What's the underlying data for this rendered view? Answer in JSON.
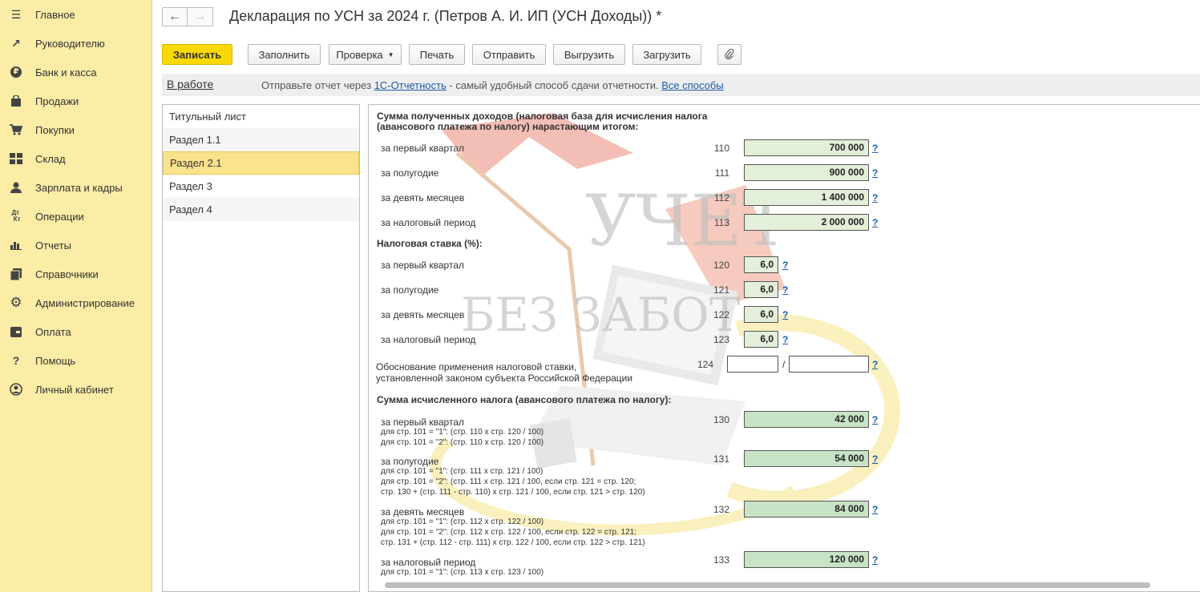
{
  "sidebar": {
    "items": [
      {
        "label": "Главное",
        "icon": "menu-icon"
      },
      {
        "label": "Руководителю",
        "icon": "trend-icon"
      },
      {
        "label": "Банк и касса",
        "icon": "ruble-icon"
      },
      {
        "label": "Продажи",
        "icon": "bag-icon"
      },
      {
        "label": "Покупки",
        "icon": "cart-icon"
      },
      {
        "label": "Склад",
        "icon": "warehouse-icon"
      },
      {
        "label": "Зарплата и кадры",
        "icon": "person-icon"
      },
      {
        "label": "Операции",
        "icon": "dt-kt-icon"
      },
      {
        "label": "Отчеты",
        "icon": "bar-chart-icon"
      },
      {
        "label": "Справочники",
        "icon": "books-icon"
      },
      {
        "label": "Администрирование",
        "icon": "gear-icon"
      },
      {
        "label": "Оплата",
        "icon": "wallet-icon"
      },
      {
        "label": "Помощь",
        "icon": "question-icon"
      },
      {
        "label": "Личный кабинет",
        "icon": "account-icon"
      }
    ]
  },
  "header": {
    "back": "←",
    "forward": "→",
    "title": "Декларация по УСН за 2024 г. (Петров А. И. ИП (УСН Доходы)) *"
  },
  "toolbar": {
    "save": "Записать",
    "fill": "Заполнить",
    "check": "Проверка",
    "print": "Печать",
    "send": "Отправить",
    "export": "Выгрузить",
    "import": "Загрузить",
    "attach_icon": "paperclip-icon"
  },
  "strip": {
    "status": "В работе",
    "msg_prefix": "Отправьте отчет через",
    "link1": "1С-Отчетность",
    "msg_mid": " - самый удобный способ сдачи отчетности.",
    "link2": "Все способы"
  },
  "sections": [
    "Титульный лист",
    "Раздел 1.1",
    "Раздел 2.1",
    "Раздел 3",
    "Раздел 4"
  ],
  "active_section": "Раздел 2.1",
  "form": {
    "income_header_1": "Сумма полученных доходов (налоговая база для исчисления налога",
    "income_header_2": "(авансового платежа по налогу) нарастающим итогом:",
    "rate_header": "Налоговая ставка (%):",
    "tax_header": "Сумма исчисленного налога (авансового платежа по налогу):",
    "justif_1": "Обоснование применения налоговой ставки,",
    "justif_2": "установленной законом субъекта Российской Федерации",
    "justif_code": "124",
    "slash": "/",
    "q": "?",
    "income_rows": [
      {
        "label": "за первый квартал",
        "code": "110",
        "value": "700 000"
      },
      {
        "label": "за полугодие",
        "code": "111",
        "value": "900 000"
      },
      {
        "label": "за девять месяцев",
        "code": "112",
        "value": "1 400 000"
      },
      {
        "label": "за налоговый период",
        "code": "113",
        "value": "2 000 000"
      }
    ],
    "rate_rows": [
      {
        "label": "за первый квартал",
        "code": "120",
        "value": "6,0"
      },
      {
        "label": "за полугодие",
        "code": "121",
        "value": "6,0"
      },
      {
        "label": "за девять месяцев",
        "code": "122",
        "value": "6,0"
      },
      {
        "label": "за налоговый период",
        "code": "123",
        "value": "6,0"
      }
    ],
    "tax_rows": [
      {
        "label": "за первый квартал",
        "code": "130",
        "value": "42 000",
        "formula": [
          "для стр. 101 = \"1\": (стр. 110 х стр. 120 / 100)",
          "для стр. 101 = \"2\": (стр. 110 х стр. 120 / 100)"
        ]
      },
      {
        "label": "за полугодие",
        "code": "131",
        "value": "54 000",
        "formula": [
          "для стр. 101 = \"1\": (стр. 111 х стр. 121 / 100)",
          "для стр. 101 = \"2\": (стр. 111 х стр. 121 / 100, если стр. 121 = стр. 120;",
          "стр. 130 + (стр. 111 - стр. 110) х стр. 121 / 100, если стр. 121 > стр. 120)"
        ]
      },
      {
        "label": "за девять месяцев",
        "code": "132",
        "value": "84 000",
        "formula": [
          "для стр. 101 = \"1\": (стр. 112 х стр. 122 / 100)",
          "для стр. 101 = \"2\": (стр. 112 х стр. 122 / 100, если стр. 122 = стр. 121;",
          "стр. 131 + (стр. 112 - стр. 111) х стр. 122 / 100, если стр. 122 > стр. 121)"
        ]
      },
      {
        "label": "за налоговый период",
        "code": "133",
        "value": "120 000",
        "formula": [
          "для стр. 101 = \"1\": (стр. 113 х стр. 123 / 100)"
        ]
      }
    ]
  },
  "watermark": {
    "line1": "УЧЕТ",
    "line2": "БЕЗ ЗАБОТ"
  }
}
